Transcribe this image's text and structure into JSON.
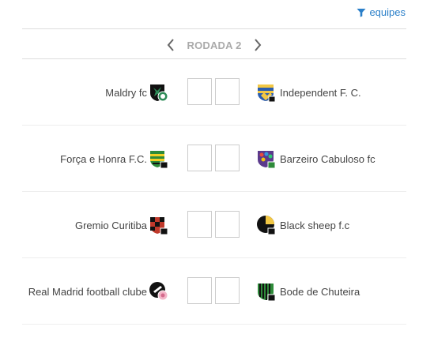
{
  "filter": {
    "label": "equipes",
    "icon": "filter-icon"
  },
  "round": {
    "label": "RODADA 2",
    "prev_icon": "chevron-left-icon",
    "next_icon": "chevron-right-icon"
  },
  "matches": [
    {
      "home": "Maldry fc",
      "away": "Independent F. C."
    },
    {
      "home": "Força e Honra F.C.",
      "away": "Barzeiro Cabuloso fc"
    },
    {
      "home": "Gremio Curitiba",
      "away": "Black sheep f.c"
    },
    {
      "home": "Real Madrid football clube",
      "away": "Bode de Chuteira"
    }
  ],
  "colors": {
    "accent": "#2a7fc9",
    "muted": "#aaaaaa",
    "rule": "#dddddd"
  }
}
